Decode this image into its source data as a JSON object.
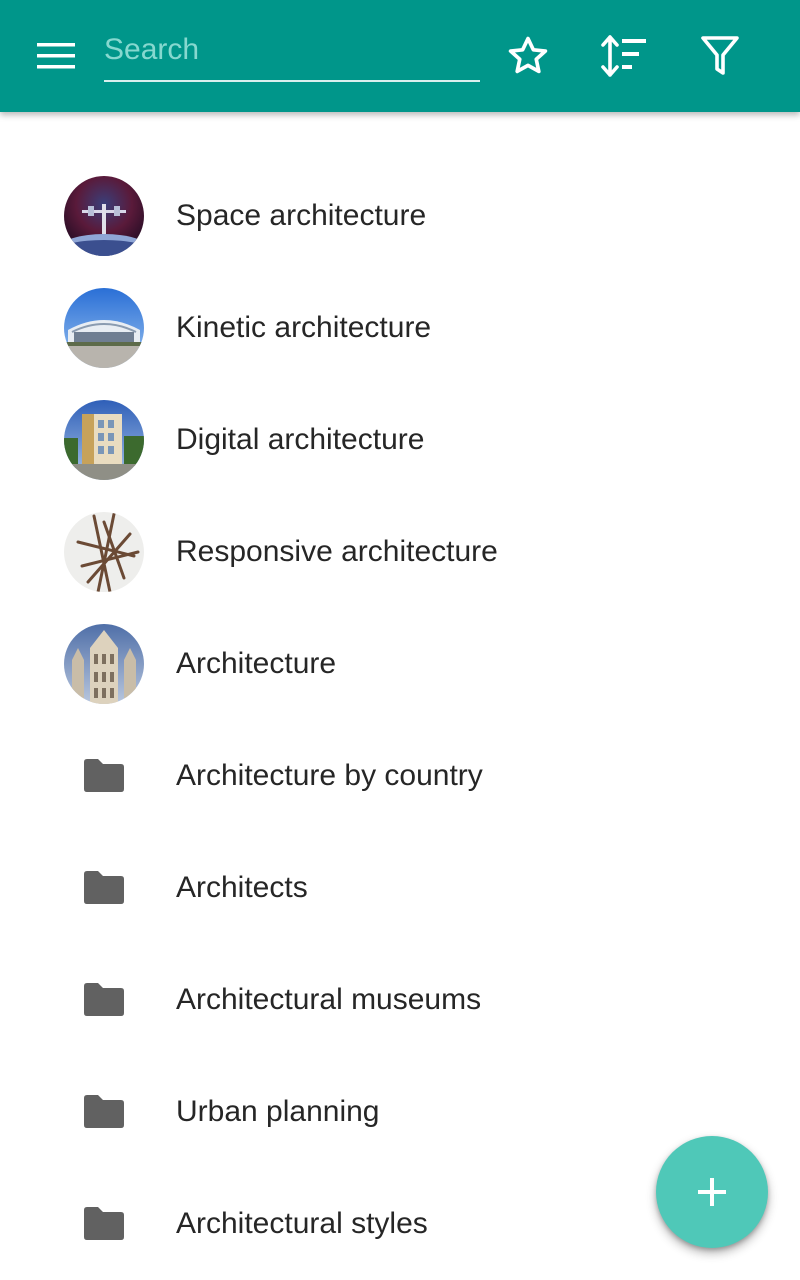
{
  "colors": {
    "app_bar": "#00968a",
    "fab": "#4fc8b8",
    "folder_icon": "#616161",
    "text_primary": "#262626",
    "search_placeholder": "#86d8cf"
  },
  "app_bar": {
    "menu_icon": "menu-icon",
    "search": {
      "placeholder": "Search",
      "value": ""
    },
    "actions": [
      {
        "icon": "star-outline-icon",
        "label": "favorites"
      },
      {
        "icon": "sort-icon",
        "label": "sort"
      },
      {
        "icon": "filter-icon",
        "label": "filter"
      }
    ]
  },
  "list": {
    "items": [
      {
        "label": "Space architecture",
        "type": "image",
        "icon": "space-architecture-thumbnail"
      },
      {
        "label": "Kinetic architecture",
        "type": "image",
        "icon": "kinetic-architecture-thumbnail"
      },
      {
        "label": "Digital architecture",
        "type": "image",
        "icon": "digital-architecture-thumbnail"
      },
      {
        "label": "Responsive architecture",
        "type": "image",
        "icon": "responsive-architecture-thumbnail"
      },
      {
        "label": "Architecture",
        "type": "image",
        "icon": "architecture-thumbnail"
      },
      {
        "label": "Architecture by country",
        "type": "folder",
        "icon": "folder-icon"
      },
      {
        "label": "Architects",
        "type": "folder",
        "icon": "folder-icon"
      },
      {
        "label": "Architectural museums",
        "type": "folder",
        "icon": "folder-icon"
      },
      {
        "label": "Urban planning",
        "type": "folder",
        "icon": "folder-icon"
      },
      {
        "label": "Architectural styles",
        "type": "folder",
        "icon": "folder-icon"
      }
    ]
  },
  "fab": {
    "icon": "plus-icon"
  }
}
